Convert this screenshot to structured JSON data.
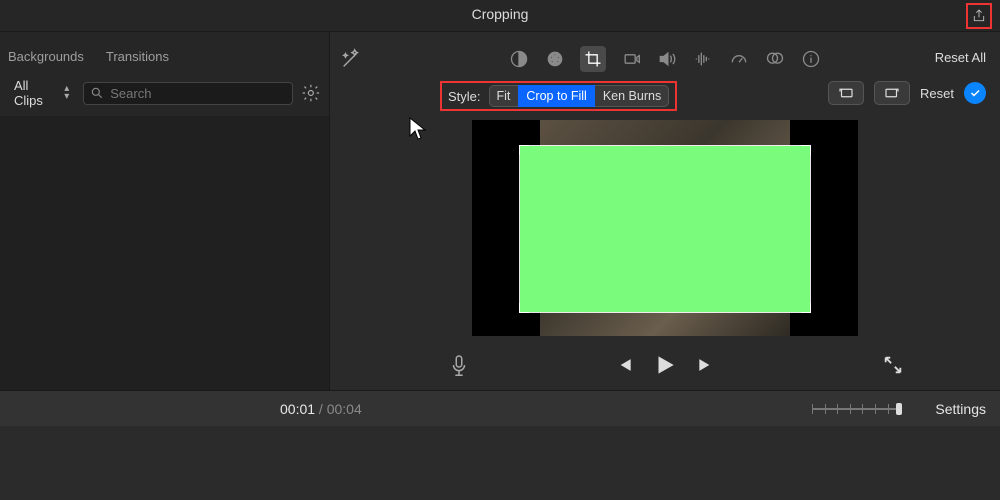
{
  "title": "Cropping",
  "sidebar": {
    "tabs": [
      "Backgrounds",
      "Transitions"
    ],
    "filter_label": "All Clips",
    "search_placeholder": "Search"
  },
  "toolbar": {
    "reset_all": "Reset All"
  },
  "style": {
    "label": "Style:",
    "options": [
      "Fit",
      "Crop to Fill",
      "Ken Burns"
    ],
    "reset": "Reset"
  },
  "timeline": {
    "current": "00:01",
    "sep": " / ",
    "duration": "00:04",
    "settings": "Settings"
  }
}
